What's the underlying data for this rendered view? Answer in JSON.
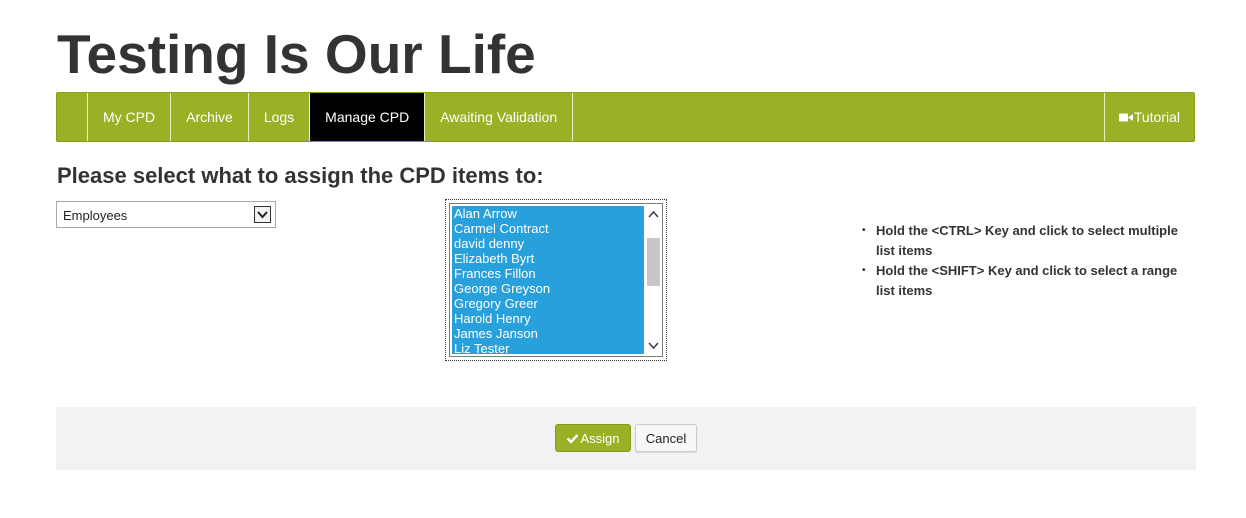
{
  "site": {
    "title": "Testing Is Our Life"
  },
  "nav": {
    "items": [
      {
        "label": "My CPD",
        "active": false
      },
      {
        "label": "Archive",
        "active": false
      },
      {
        "label": "Logs",
        "active": false
      },
      {
        "label": "Manage CPD",
        "active": true
      },
      {
        "label": "Awaiting Validation",
        "active": false
      }
    ],
    "tutorial_label": "Tutorial",
    "tutorial_icon": "video-camera-icon"
  },
  "main": {
    "heading": "Please select what to assign the CPD items to:",
    "assign_type_select": {
      "selected": "Employees",
      "icon": "chevron-down-icon"
    },
    "employee_list": {
      "items": [
        "Alan Arrow",
        "Carmel Contract",
        "david denny",
        "Elizabeth Byrt",
        "Frances Fillon",
        "George Greyson",
        "Gregory Greer",
        "Harold Henry",
        "James Janson",
        "Liz Tester"
      ],
      "selection_color": "#28a0dc"
    },
    "hints": [
      "Hold the <CTRL> Key and click to select multiple list items",
      "Hold the <SHIFT> Key and click to select a range list items"
    ]
  },
  "actions": {
    "assign_label": "Assign",
    "assign_icon": "check-icon",
    "cancel_label": "Cancel"
  },
  "colors": {
    "brand_green": "#9ab125",
    "active_tab": "#000000",
    "action_bar_bg": "#f2f2f2"
  }
}
